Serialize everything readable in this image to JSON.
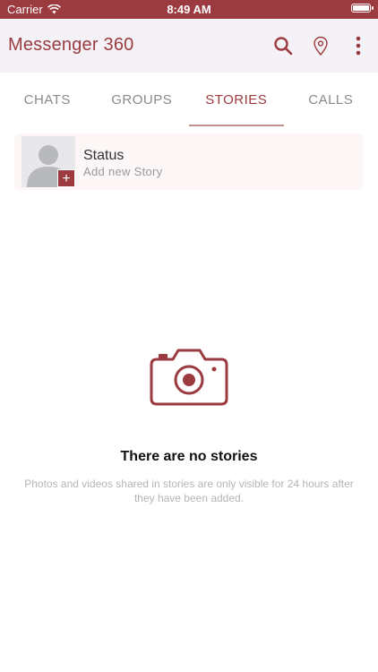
{
  "status_bar": {
    "carrier": "Carrier",
    "time": "8:49 AM",
    "wifi_icon": "wifi-icon",
    "battery_icon": "battery-icon"
  },
  "app_bar": {
    "title": "Messenger 360",
    "actions": [
      "search-icon",
      "location-pin-icon",
      "more-vertical-icon"
    ]
  },
  "tabs": [
    {
      "label": "CHATS",
      "active": false
    },
    {
      "label": "GROUPS",
      "active": false
    },
    {
      "label": "STORIES",
      "active": true
    },
    {
      "label": "CALLS",
      "active": false
    }
  ],
  "status_card": {
    "title": "Status",
    "subtitle": "Add new Story",
    "badge": "+"
  },
  "empty_state": {
    "icon": "camera-icon",
    "title": "There are no stories",
    "description": "Photos and videos shared in stories are only visible for 24 hours after they have been added."
  },
  "colors": {
    "accent": "#9b3b40",
    "app_bar_bg": "#f4f2f7",
    "card_bg": "#fcf6f6",
    "inactive_tab": "#8a8a8a"
  }
}
